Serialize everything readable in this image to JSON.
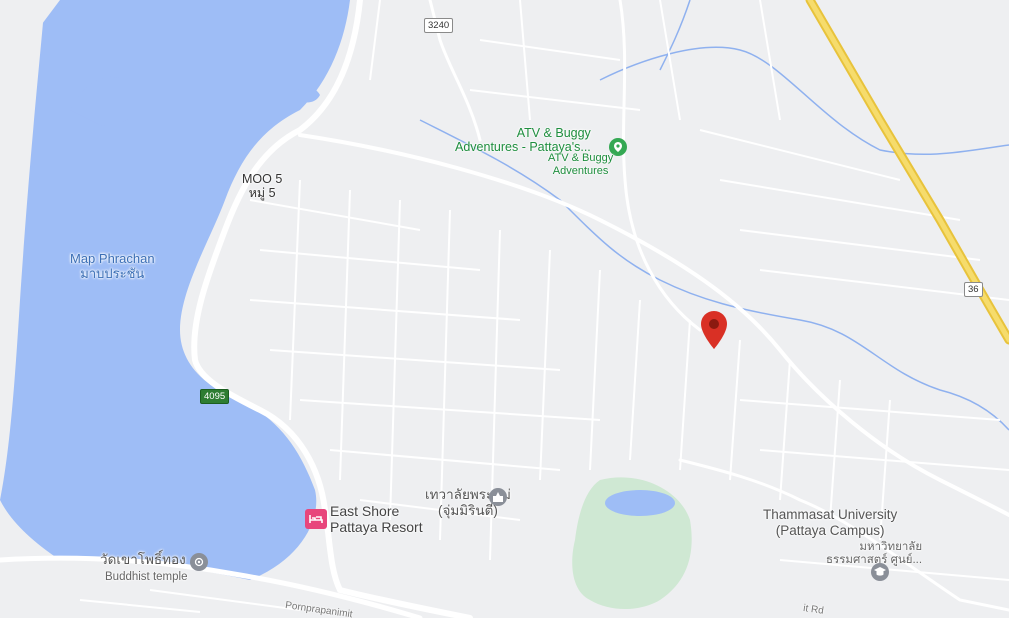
{
  "map": {
    "water_body": {
      "name_en": "Map Phrachan",
      "name_th": "มาบประชัน"
    },
    "area": {
      "name_en": "MOO 5",
      "name_th": "หมู่ 5"
    },
    "pois": {
      "atv": {
        "title": "ATV & Buggy",
        "title2": "Adventures -  Pattaya's...",
        "sub1": "ATV & Buggy",
        "sub2": "Adventures"
      },
      "shrine": {
        "line1": "เทวาลัยพระแม่",
        "line2": "(จุ่มมิรินตี)"
      },
      "hotel": {
        "line1": "East Shore",
        "line2": "Pattaya Resort"
      },
      "temple": {
        "name": "วัดเขาโพธิ์ทอง",
        "sub": "Buddhist temple"
      },
      "university": {
        "line1": "Thammasat University",
        "line2": "(Pattaya Campus)",
        "th1": "มหาวิทยาลัย",
        "th2": "ธรรมศาสตร์ ศูนย์..."
      }
    },
    "road_shields": {
      "r3240": "3240",
      "r4095": "4095",
      "r36": "36"
    },
    "road_labels": {
      "pornprapanimit": "Pornprapanimit",
      "rd": "it Rd"
    },
    "colors": {
      "water": "#9ebdf6",
      "land": "#eeeff1",
      "road": "#ffffff",
      "highway": "#f1d14f",
      "green": "#cfe8d3",
      "marker": "#d93025",
      "poi_green": "#34a853",
      "hotel": "#e8467c"
    },
    "icons": {
      "marker": "red-location-pin-icon",
      "atv": "green-poi-icon",
      "shrine": "worship-icon",
      "hotel": "hotel-icon",
      "temple": "temple-icon",
      "university": "school-icon"
    }
  }
}
